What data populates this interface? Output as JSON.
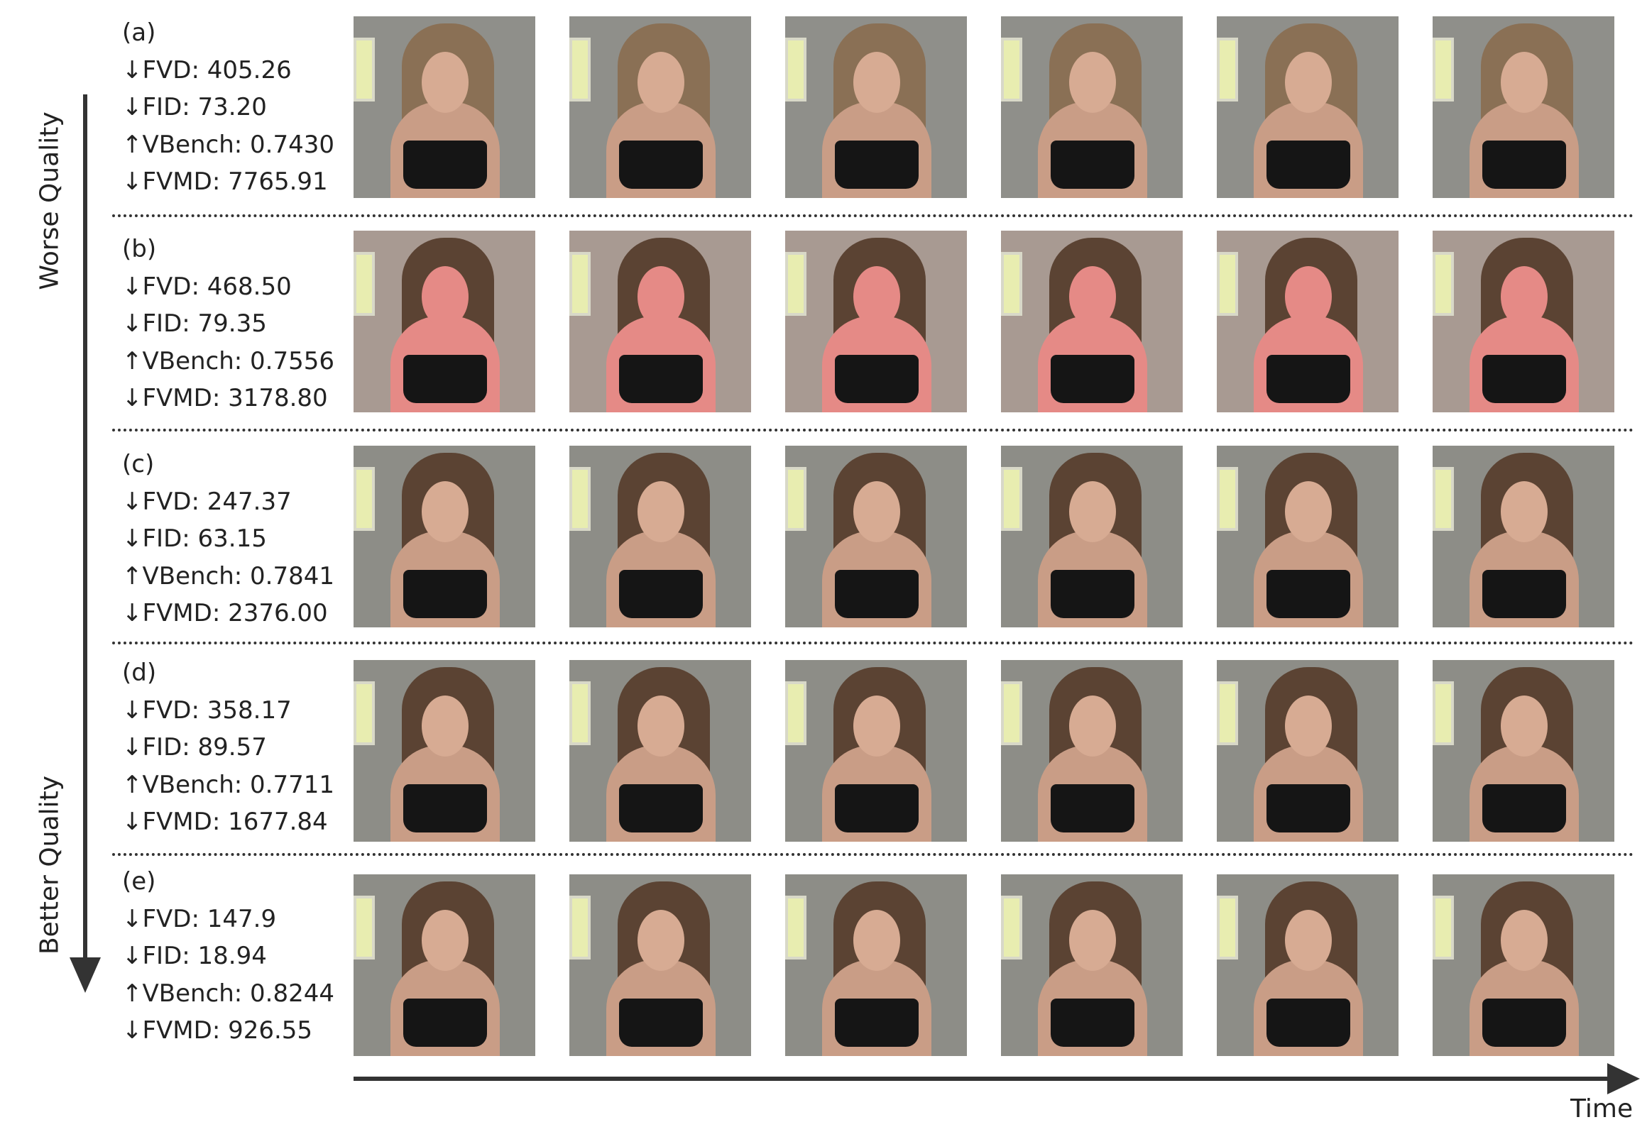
{
  "figure": {
    "quality_axis": {
      "top_label": "Worse Quality",
      "bottom_label": "Better Quality"
    },
    "time_axis": {
      "label": "Time"
    },
    "rows": [
      {
        "id": "(a)",
        "metrics": [
          "↓FVD: 405.26",
          "↓FID: 73.20",
          "↑VBench: 0.7430",
          "↓FVMD: 7765.91"
        ]
      },
      {
        "id": "(b)",
        "metrics": [
          "↓FVD: 468.50",
          "↓FID: 79.35",
          "↑VBench: 0.7556",
          "↓FVMD: 3178.80"
        ]
      },
      {
        "id": "(c)",
        "metrics": [
          "↓FVD: 247.37",
          "↓FID: 63.15",
          "↑VBench: 0.7841",
          "↓FVMD: 2376.00"
        ]
      },
      {
        "id": "(d)",
        "metrics": [
          "↓FVD: 358.17",
          "↓FID: 89.57",
          "↑VBench: 0.7711",
          "↓FVMD: 1677.84"
        ]
      },
      {
        "id": "(e)",
        "metrics": [
          "↓FVD: 147.9",
          "↓FID: 18.94",
          "↑VBench: 0.8244",
          "↓FVMD: 926.55"
        ]
      }
    ]
  }
}
